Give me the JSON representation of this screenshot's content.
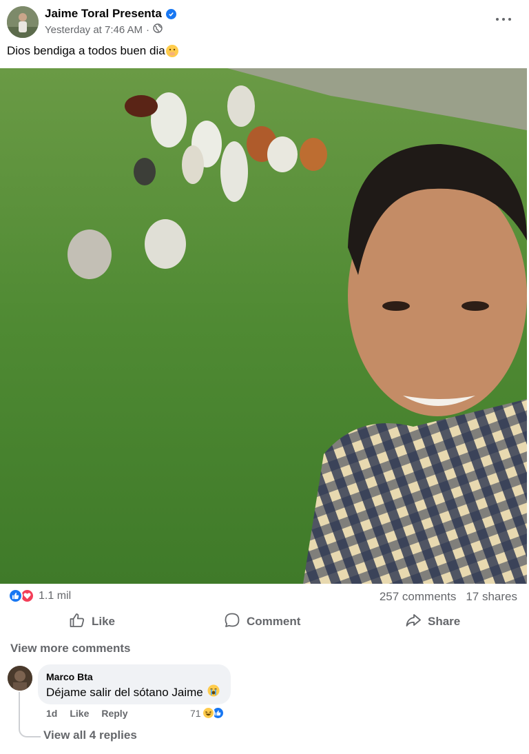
{
  "post": {
    "author": "Jaime Toral Presenta",
    "timestamp": "Yesterday at 7:46 AM",
    "separator": "·",
    "privacy_icon": "globe-icon",
    "caption": "Dios bendiga a todos buen dia",
    "caption_emoji": "face-with-hand-over-mouth-emoji"
  },
  "stats": {
    "reactions_count": "1.1 mil",
    "reaction_icons": [
      "like",
      "love"
    ],
    "comments": "257 comments",
    "shares": "17 shares"
  },
  "actions": {
    "like": "Like",
    "comment": "Comment",
    "share": "Share"
  },
  "comments_section": {
    "view_more": "View more comments",
    "comment": {
      "author": "Marco Bta",
      "text": "Déjame salir del sótano Jaime",
      "emoji": "crying-face-emoji",
      "age": "1d",
      "like": "Like",
      "reply": "Reply",
      "reaction_count": "71",
      "reaction_icons": [
        "haha",
        "like"
      ]
    },
    "view_replies": "View all 4 replies"
  },
  "colors": {
    "brand_blue": "#1877f2",
    "love_red": "#f33e58",
    "secondary_text": "#65676b",
    "bubble_bg": "#f0f2f5"
  }
}
